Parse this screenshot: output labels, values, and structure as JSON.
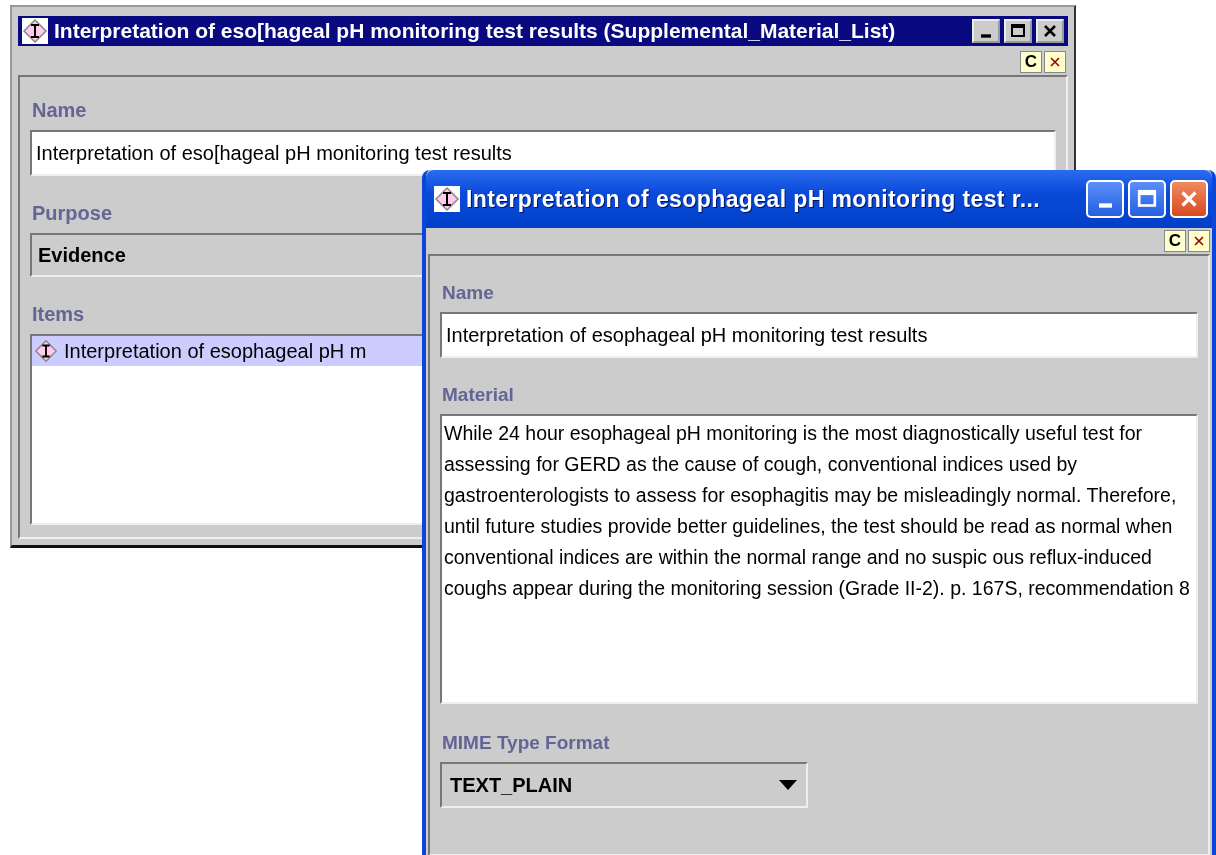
{
  "windows": [
    {
      "title": "Interpretation of eso[hageal pH monitoring test results (Supplemental_Material_List)",
      "toolbar": {
        "label": "C"
      },
      "fields": [
        {
          "kind": "text",
          "label": "Name",
          "value": "Interpretation of eso[hageal pH monitoring test results"
        },
        {
          "kind": "combo",
          "label": "Purpose",
          "value": "Evidence"
        },
        {
          "kind": "list",
          "label": "Items",
          "items": [
            {
              "text": "Interpretation of esophageal pH m",
              "selected": true
            }
          ]
        }
      ]
    },
    {
      "title": "Interpretation of esophageal pH monitoring test r...",
      "toolbar": {
        "label": "C"
      },
      "fields": [
        {
          "kind": "text",
          "label": "Name",
          "value": "Interpretation of esophageal pH monitoring test results"
        },
        {
          "kind": "textarea",
          "label": "Material",
          "value": " While 24 hour esophageal pH monitoring is the most diagnostically useful test for assessing for GERD as the cause of cough, conventional indices used by gastroenterologists to assess for esophagitis may be misleadingly normal. Therefore, until future studies provide better guidelines, the test should be read as normal when conventional indices are within the normal range and no suspic ous reflux-induced coughs appear during the monitoring session (Grade II-2). p. 167S, recommendation 8"
        },
        {
          "kind": "dropdown",
          "label": "MIME Type Format",
          "value": "TEXT_PLAIN"
        }
      ]
    }
  ]
}
